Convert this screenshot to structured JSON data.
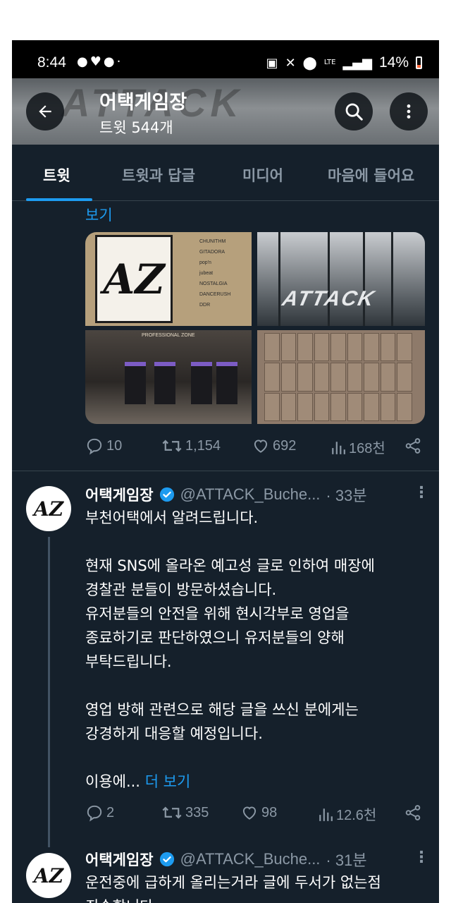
{
  "status_bar": {
    "time": "8:44",
    "notification_icons": [
      "message-icon",
      "heart-icon",
      "talk-icon",
      "dot-icon"
    ],
    "system_icons": [
      "battery-saver-icon",
      "mute-icon",
      "location-icon",
      "lte-icon",
      "signal-icon"
    ],
    "lte_label": "LTE",
    "battery": "14%"
  },
  "header": {
    "title": "어택게임장",
    "subtitle": "트윗 544개"
  },
  "tabs": [
    {
      "label": "트윗",
      "active": true
    },
    {
      "label": "트윗과 답글",
      "active": false
    },
    {
      "label": "미디어",
      "active": false
    },
    {
      "label": "마음에 들어요",
      "active": false
    }
  ],
  "first_tweet": {
    "see_more": "보기",
    "media": {
      "logo_text": "AZ",
      "menu_items": [
        "CHUNITHM",
        "GITADORA",
        "pop'n",
        "jubeat",
        "NOSTALGIA",
        "DANCERUSH",
        "DDR"
      ],
      "door_text": "ATTACK",
      "zone_text": "PROFESSIONAL ZONE"
    },
    "actions": {
      "replies": "10",
      "retweets": "1,154",
      "likes": "692",
      "views": "168천"
    }
  },
  "tweets": [
    {
      "avatar_text": "AZ",
      "name": "어택게임장",
      "handle": "@ATTACK_Buche...",
      "time": "· 33분",
      "paragraphs": [
        [
          "부천어택에서 알려드립니다."
        ],
        [
          "현재 SNS에 올라온 예고성 글로 인하여 매장에",
          "경찰관 분들이 방문하셨습니다.",
          "유저분들의 안전을 위해 현시각부로 영업을",
          "종료하기로 판단하였으니 유저분들의 양해",
          "부탁드립니다."
        ],
        [
          "영업 방해 관련으로 해당 글을 쓰신 분에게는",
          "강경하게 대응할 예정입니다."
        ]
      ],
      "truncated_text": "이용에...",
      "more_link": "더 보기",
      "actions": {
        "replies": "2",
        "retweets": "335",
        "likes": "98",
        "views": "12.6천"
      }
    },
    {
      "avatar_text": "AZ",
      "name": "어택게임장",
      "handle": "@ATTACK_Buche...",
      "time": "· 31분",
      "lines": [
        "운전중에 급하게 올리는거라 글에 두서가 없는점",
        "죄송합니다."
      ]
    }
  ],
  "colors": {
    "background": "#15202b",
    "accent": "#1d9bf0",
    "muted_text": "#8b98a5",
    "divider": "#38444d",
    "status_bar": "#000000"
  }
}
